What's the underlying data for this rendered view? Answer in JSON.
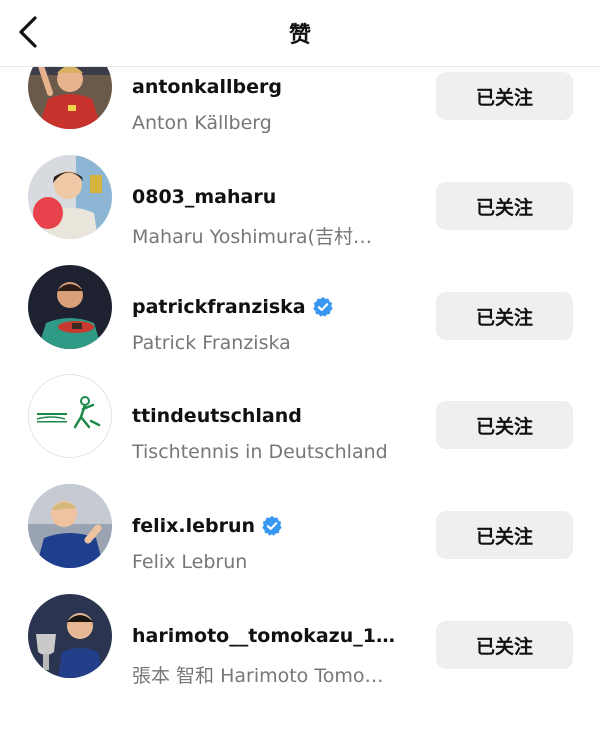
{
  "header": {
    "title": "赞"
  },
  "follow_label": "已关注",
  "users": [
    {
      "username": "antonkallberg",
      "full_name": "Anton Källberg",
      "verified": false,
      "avatar": "player-red-shirt-avatar"
    },
    {
      "username": "0803_maharu",
      "full_name": "Maharu Yoshimura(吉村…",
      "verified": false,
      "avatar": "player-with-paddle-avatar"
    },
    {
      "username": "patrickfranziska",
      "full_name": "Patrick Franziska",
      "verified": true,
      "avatar": "player-green-shirt-avatar"
    },
    {
      "username": "ttindeutschland",
      "full_name": "Tischtennis in Deutschland",
      "verified": false,
      "avatar": "tt-logo-avatar"
    },
    {
      "username": "felix.lebrun",
      "full_name": "Felix Lebrun",
      "verified": true,
      "avatar": "player-blue-shirt-avatar"
    },
    {
      "username": "harimoto__tomokazu_1…",
      "full_name": "張本 智和 Harimoto Tomo…",
      "verified": false,
      "avatar": "player-trophy-avatar"
    }
  ],
  "colors": {
    "verified": "#3897f0",
    "button_bg": "#efefef",
    "secondary_text": "#777777"
  }
}
